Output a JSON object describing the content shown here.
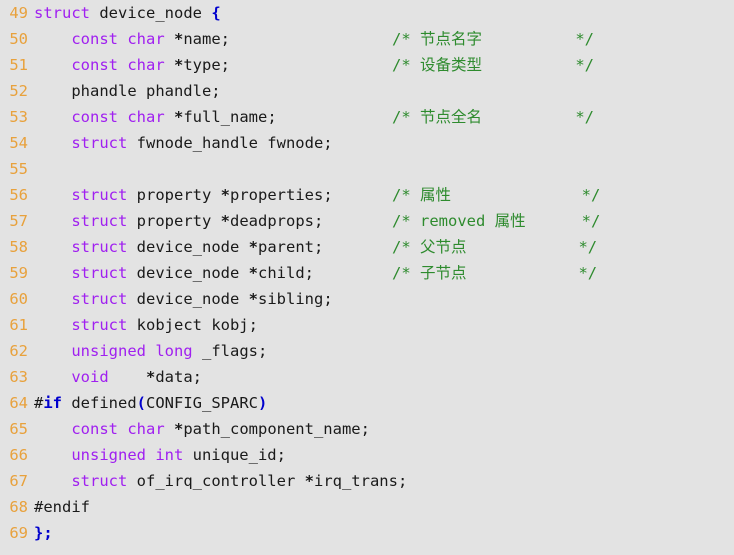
{
  "editor": {
    "background_color": "#e3e3e3",
    "linenumber_color": "#e8a13c",
    "keyword_color": "#a020f0",
    "comment_color": "#2e8b2e",
    "punctuation_color": "#0000cd",
    "text_color": "#1a1a1a",
    "language": "C",
    "first_line": 49,
    "last_line": 69
  },
  "lines": [
    {
      "num": "49",
      "indent": "",
      "code": "struct device_node {",
      "tokens": [
        {
          "t": "struct",
          "c": "kw"
        },
        {
          "t": " device_node ",
          "c": "plain"
        },
        {
          "t": "{",
          "c": "brace"
        }
      ],
      "comment": ""
    },
    {
      "num": "50",
      "indent": "    ",
      "code": "const char *name;",
      "tokens": [
        {
          "t": "const char ",
          "c": "kw"
        },
        {
          "t": "*",
          "c": "star"
        },
        {
          "t": "name;",
          "c": "plain"
        }
      ],
      "comment": "/* 节点名字          */"
    },
    {
      "num": "51",
      "indent": "    ",
      "code": "const char *type;",
      "tokens": [
        {
          "t": "const char ",
          "c": "kw"
        },
        {
          "t": "*",
          "c": "star"
        },
        {
          "t": "type;",
          "c": "plain"
        }
      ],
      "comment": "/* 设备类型          */"
    },
    {
      "num": "52",
      "indent": "    ",
      "code": "phandle phandle;",
      "tokens": [
        {
          "t": "phandle phandle;",
          "c": "plain"
        }
      ],
      "comment": ""
    },
    {
      "num": "53",
      "indent": "    ",
      "code": "const char *full_name;",
      "tokens": [
        {
          "t": "const char ",
          "c": "kw"
        },
        {
          "t": "*",
          "c": "star"
        },
        {
          "t": "full_name;",
          "c": "plain"
        }
      ],
      "comment": "/* 节点全名          */"
    },
    {
      "num": "54",
      "indent": "    ",
      "code": "struct fwnode_handle fwnode;",
      "tokens": [
        {
          "t": "struct",
          "c": "kw"
        },
        {
          "t": " fwnode_handle fwnode;",
          "c": "plain"
        }
      ],
      "comment": ""
    },
    {
      "num": "55",
      "indent": "",
      "code": "",
      "tokens": [],
      "comment": ""
    },
    {
      "num": "56",
      "indent": "    ",
      "code": "struct property *properties;",
      "tokens": [
        {
          "t": "struct",
          "c": "kw"
        },
        {
          "t": " property ",
          "c": "plain"
        },
        {
          "t": "*",
          "c": "star"
        },
        {
          "t": "properties;",
          "c": "plain"
        }
      ],
      "comment": "/* 属性              */"
    },
    {
      "num": "57",
      "indent": "    ",
      "code": "struct property *deadprops;",
      "tokens": [
        {
          "t": "struct",
          "c": "kw"
        },
        {
          "t": " property ",
          "c": "plain"
        },
        {
          "t": "*",
          "c": "star"
        },
        {
          "t": "deadprops;",
          "c": "plain"
        }
      ],
      "comment": "/* removed 属性      */"
    },
    {
      "num": "58",
      "indent": "    ",
      "code": "struct device_node *parent;",
      "tokens": [
        {
          "t": "struct",
          "c": "kw"
        },
        {
          "t": " device_node ",
          "c": "plain"
        },
        {
          "t": "*",
          "c": "star"
        },
        {
          "t": "parent;",
          "c": "plain"
        }
      ],
      "comment": "/* 父节点            */"
    },
    {
      "num": "59",
      "indent": "    ",
      "code": "struct device_node *child;",
      "tokens": [
        {
          "t": "struct",
          "c": "kw"
        },
        {
          "t": " device_node ",
          "c": "plain"
        },
        {
          "t": "*",
          "c": "star"
        },
        {
          "t": "child;",
          "c": "plain"
        }
      ],
      "comment": "/* 子节点            */"
    },
    {
      "num": "60",
      "indent": "    ",
      "code": "struct device_node *sibling;",
      "tokens": [
        {
          "t": "struct",
          "c": "kw"
        },
        {
          "t": " device_node ",
          "c": "plain"
        },
        {
          "t": "*",
          "c": "star"
        },
        {
          "t": "sibling;",
          "c": "plain"
        }
      ],
      "comment": ""
    },
    {
      "num": "61",
      "indent": "    ",
      "code": "struct kobject kobj;",
      "tokens": [
        {
          "t": "struct",
          "c": "kw"
        },
        {
          "t": " kobject kobj;",
          "c": "plain"
        }
      ],
      "comment": ""
    },
    {
      "num": "62",
      "indent": "    ",
      "code": "unsigned long _flags;",
      "tokens": [
        {
          "t": "unsigned long",
          "c": "kw"
        },
        {
          "t": " _flags;",
          "c": "plain"
        }
      ],
      "comment": ""
    },
    {
      "num": "63",
      "indent": "    ",
      "code": "void    *data;",
      "tokens": [
        {
          "t": "void",
          "c": "kw"
        },
        {
          "t": "    ",
          "c": "plain"
        },
        {
          "t": "*",
          "c": "star"
        },
        {
          "t": "data;",
          "c": "plain"
        }
      ],
      "comment": ""
    },
    {
      "num": "64",
      "indent": "",
      "code": "#if defined(CONFIG_SPARC)",
      "tokens": [
        {
          "t": "#",
          "c": "pp"
        },
        {
          "t": "if",
          "c": "ppkw"
        },
        {
          "t": " defined",
          "c": "plain"
        },
        {
          "t": "(",
          "c": "paren"
        },
        {
          "t": "CONFIG_SPARC",
          "c": "plain"
        },
        {
          "t": ")",
          "c": "paren"
        }
      ],
      "comment": ""
    },
    {
      "num": "65",
      "indent": "    ",
      "code": "const char *path_component_name;",
      "tokens": [
        {
          "t": "const char ",
          "c": "kw"
        },
        {
          "t": "*",
          "c": "star"
        },
        {
          "t": "path_component_name;",
          "c": "plain"
        }
      ],
      "comment": ""
    },
    {
      "num": "66",
      "indent": "    ",
      "code": "unsigned int unique_id;",
      "tokens": [
        {
          "t": "unsigned int",
          "c": "kw"
        },
        {
          "t": " unique_id;",
          "c": "plain"
        }
      ],
      "comment": ""
    },
    {
      "num": "67",
      "indent": "    ",
      "code": "struct of_irq_controller *irq_trans;",
      "tokens": [
        {
          "t": "struct",
          "c": "kw"
        },
        {
          "t": " of_irq_controller ",
          "c": "plain"
        },
        {
          "t": "*",
          "c": "star"
        },
        {
          "t": "irq_trans;",
          "c": "plain"
        }
      ],
      "comment": ""
    },
    {
      "num": "68",
      "indent": "",
      "code": "#endif",
      "tokens": [
        {
          "t": "#endif",
          "c": "pp"
        }
      ],
      "comment": ""
    },
    {
      "num": "69",
      "indent": "",
      "code": "};",
      "tokens": [
        {
          "t": "};",
          "c": "brace"
        }
      ],
      "comment": ""
    }
  ]
}
